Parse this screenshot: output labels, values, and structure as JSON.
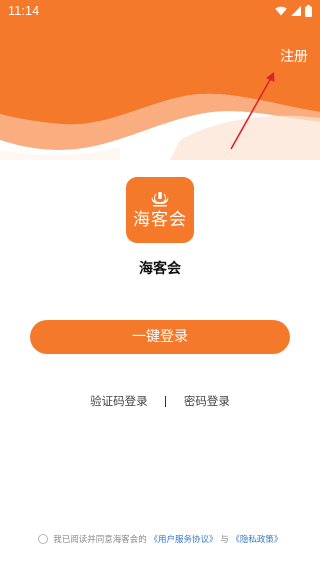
{
  "status_bar": {
    "time": "11:14",
    "icons": [
      "wifi-icon",
      "signal-icon",
      "battery-icon"
    ]
  },
  "header": {
    "register_label": "注册"
  },
  "app": {
    "logo_text": "海客会",
    "name": "海客会"
  },
  "login": {
    "primary_label": "一键登录",
    "sms_login_label": "验证码登录",
    "password_login_label": "密码登录"
  },
  "agreement": {
    "prefix": "我已阅读并同意海客会的",
    "user_agreement": "《用户服务协议》",
    "conjunction": "与",
    "privacy_policy": "《隐私政策》",
    "checked": false
  },
  "colors": {
    "brand_orange": "#f5792a",
    "link_blue": "#3a78c9",
    "annotation_red": "#d9262c"
  }
}
